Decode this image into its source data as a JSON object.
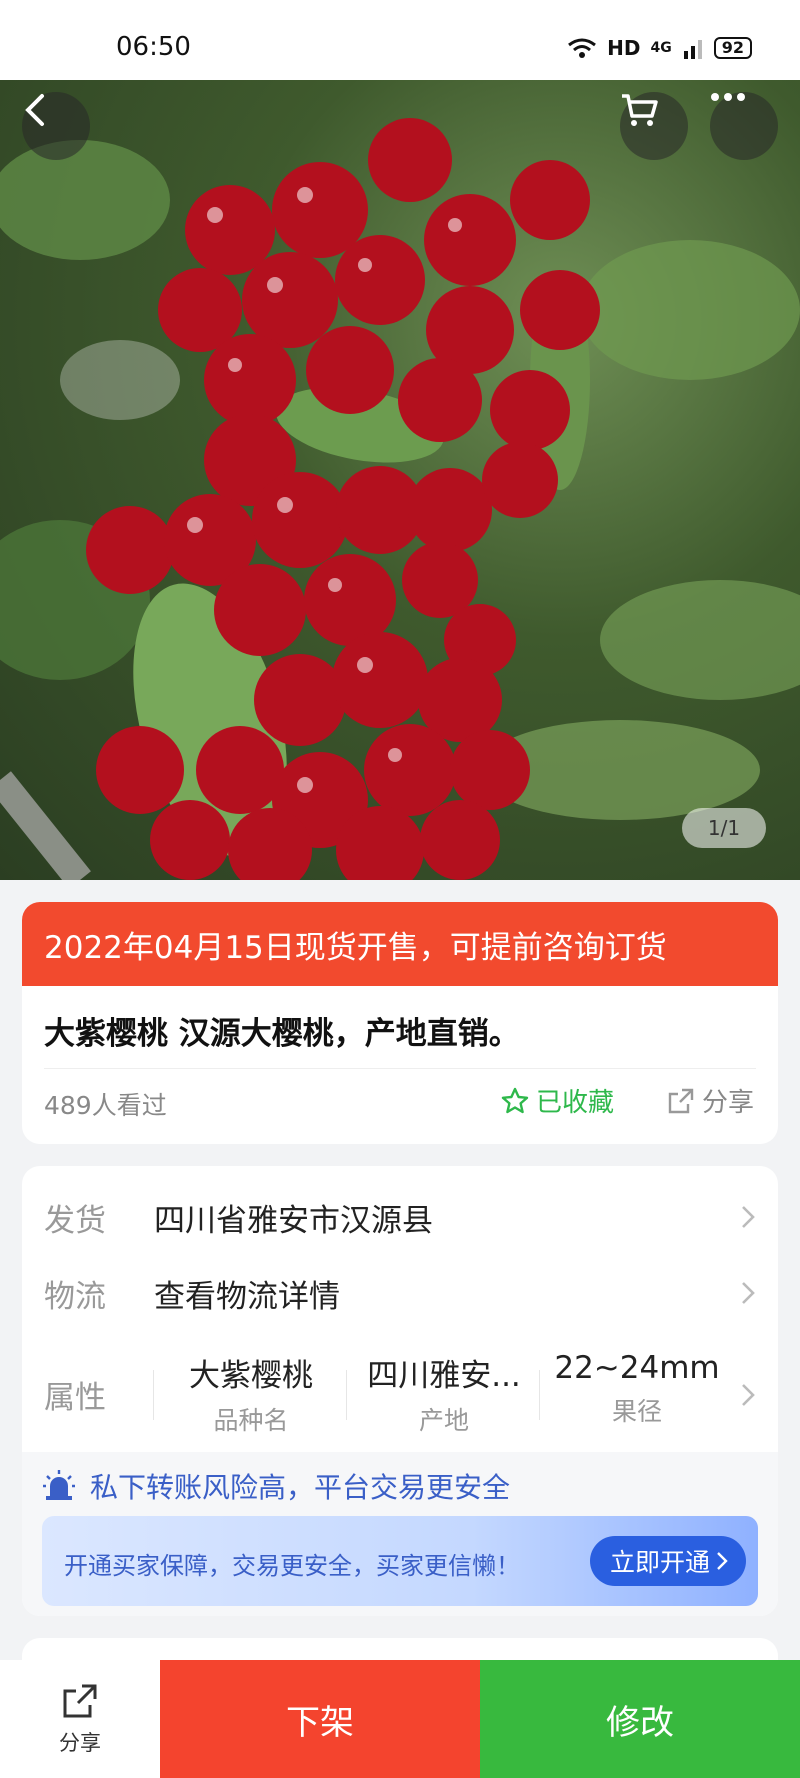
{
  "status_bar": {
    "time": "06:50",
    "hd": "HD",
    "signal": "4G",
    "battery": "92"
  },
  "gallery": {
    "page_indicator": "1/1"
  },
  "product": {
    "promo_banner": "2022年04月15日现货开售，可提前咨询订货",
    "title": "大紫樱桃 汉源大樱桃，产地直销。",
    "views": "489人看过",
    "favorite_label": "已收藏",
    "share_label": "分享"
  },
  "details": {
    "shipping_label": "发货",
    "shipping_value": "四川省雅安市汉源县",
    "logistics_label": "物流",
    "logistics_value": "查看物流详情",
    "attributes_label": "属性",
    "attributes": [
      {
        "value": "大紫樱桃",
        "name": "品种名"
      },
      {
        "value": "四川雅安...",
        "name": "产地"
      },
      {
        "value": "22~24mm",
        "name": "果径"
      }
    ]
  },
  "safety": {
    "warning": "私下转账风险高，平台交易更安全",
    "protect_text": "开通买家保障，交易更安全，买家更信懒！",
    "protect_button": "立即开通"
  },
  "bottom_bar": {
    "share_label": "分享",
    "take_down_label": "下架",
    "edit_label": "修改"
  },
  "colors": {
    "promo_red": "#f24a2e",
    "fav_green": "#2eb84b",
    "take_down_red": "#f4442e",
    "edit_green": "#38b93e",
    "protect_blue": "#2a5fe0"
  }
}
